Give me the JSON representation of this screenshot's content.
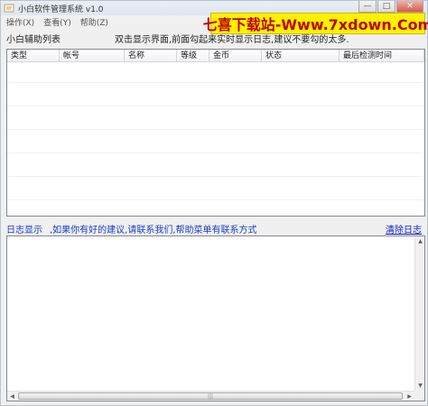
{
  "window": {
    "title": "小白软件管理系统   v1.0",
    "watermark": "七喜下载站-Www.7xdown.Com"
  },
  "menu": {
    "items": [
      {
        "label": "操作(X)"
      },
      {
        "label": "查看(Y)"
      },
      {
        "label": "帮助(Z)"
      }
    ]
  },
  "header": {
    "list_title": "小白辅助列表",
    "hint": "双击显示界面,前面勾起来实时显示日志,建议不要勾的太多."
  },
  "table": {
    "columns": [
      {
        "label": "类型"
      },
      {
        "label": "帐号"
      },
      {
        "label": "名称"
      },
      {
        "label": "等级"
      },
      {
        "label": "金币"
      },
      {
        "label": "状态"
      },
      {
        "label": "最后检测时间"
      }
    ],
    "rows": []
  },
  "log": {
    "label": "日志显示",
    "hint": ",如果你有好的建议,请联系我们,帮助菜单有联系方式",
    "clear_link": "清除日志",
    "content": ""
  },
  "colors": {
    "log_text": "#1a3cc8",
    "watermark_bg": "#fff200",
    "watermark_text": "#c00000"
  }
}
